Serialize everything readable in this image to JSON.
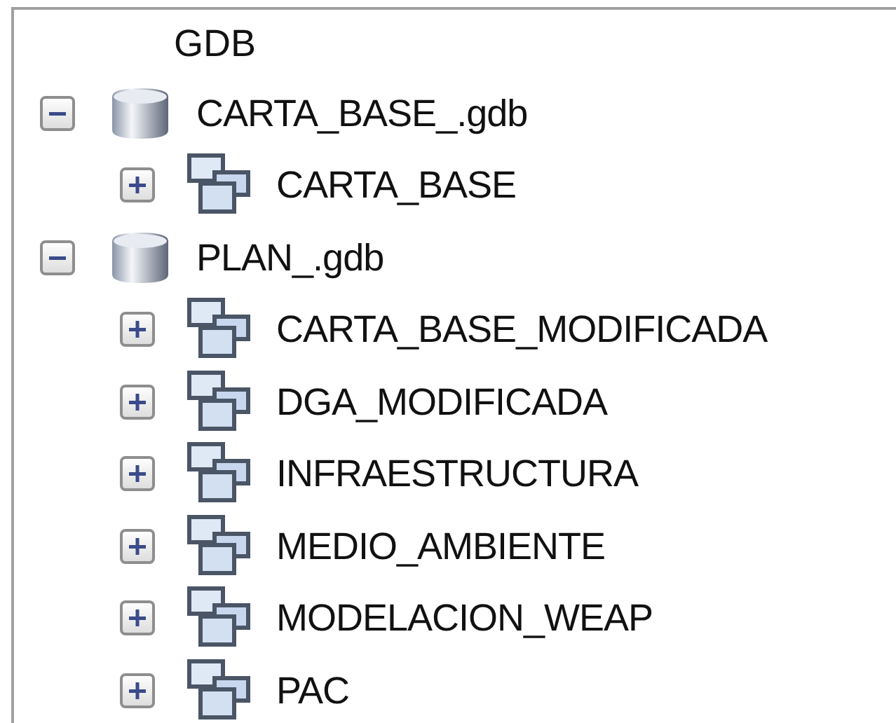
{
  "tree": {
    "root": {
      "label": "GDB"
    },
    "items": [
      {
        "label": "CARTA_BASE_.gdb",
        "kind": "database",
        "expanded": true,
        "children": [
          {
            "label": "CARTA_BASE",
            "kind": "dataset",
            "expanded": false
          }
        ]
      },
      {
        "label": "PLAN_.gdb",
        "kind": "database",
        "expanded": true,
        "children": [
          {
            "label": "CARTA_BASE_MODIFICADA",
            "kind": "dataset",
            "expanded": false
          },
          {
            "label": "DGA_MODIFICADA",
            "kind": "dataset",
            "expanded": false
          },
          {
            "label": "INFRAESTRUCTURA",
            "kind": "dataset",
            "expanded": false
          },
          {
            "label": "MEDIO_AMBIENTE",
            "kind": "dataset",
            "expanded": false
          },
          {
            "label": "MODELACION_WEAP",
            "kind": "dataset",
            "expanded": false
          },
          {
            "label": "PAC",
            "kind": "dataset",
            "expanded": false
          }
        ]
      }
    ]
  }
}
